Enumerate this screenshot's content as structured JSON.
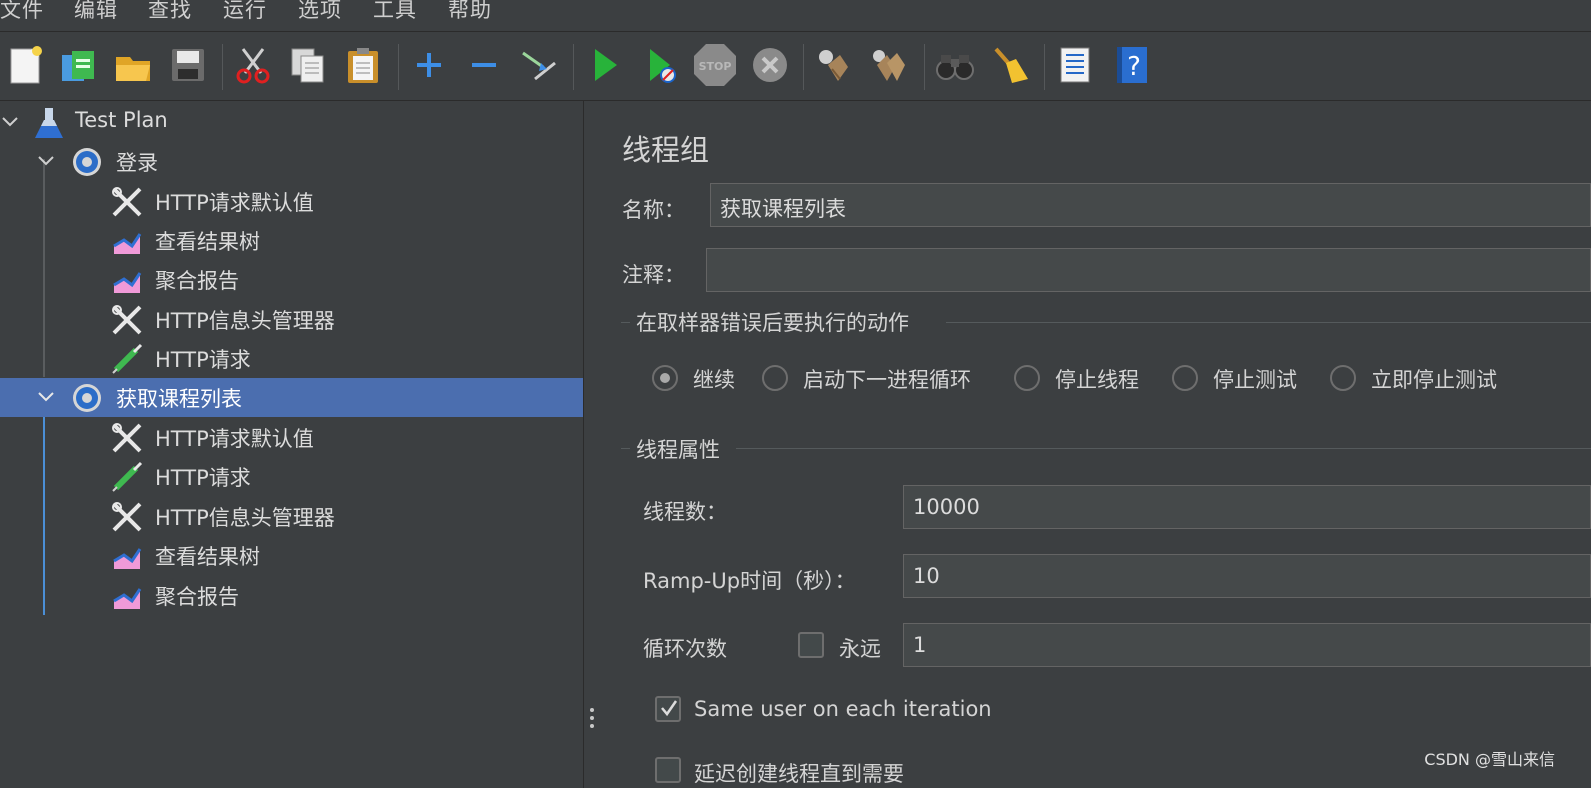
{
  "menu": [
    "文件",
    "编辑",
    "查找",
    "运行",
    "选项",
    "工具",
    "帮助"
  ],
  "toolbar": {
    "icons": [
      "new-icon",
      "templates-icon",
      "open-icon",
      "save-icon",
      "cut-icon",
      "copy-icon",
      "paste-icon",
      "expand-icon",
      "collapse-icon",
      "toggle-icon",
      "start-icon",
      "start-no-pause-icon",
      "stop-icon",
      "shutdown-icon",
      "clear-icon",
      "clear-all-icon",
      "search-icon",
      "reset-search-icon",
      "function-helper-icon",
      "help-icon"
    ]
  },
  "tree": {
    "root": "Test Plan",
    "groups": [
      {
        "label": "登录",
        "children": [
          "HTTP请求默认值",
          "查看结果树",
          "聚合报告",
          "HTTP信息头管理器",
          "HTTP请求"
        ]
      },
      {
        "label": "获取课程列表",
        "children": [
          "HTTP请求默认值",
          "HTTP请求",
          "HTTP信息头管理器",
          "查看结果树",
          "聚合报告"
        ]
      }
    ]
  },
  "panel": {
    "title": "线程组",
    "name_label": "名称：",
    "name_value": "获取课程列表",
    "comment_label": "注释：",
    "comment_value": "",
    "error_section": "在取样器错误后要执行的动作",
    "error_options": [
      "继续",
      "启动下一进程循环",
      "停止线程",
      "停止测试",
      "立即停止测试"
    ],
    "error_selected": "继续",
    "thread_section": "线程属性",
    "threads_label": "线程数：",
    "threads_value": "10000",
    "rampup_label": "Ramp-Up时间（秒）：",
    "rampup_value": "10",
    "loop_label": "循环次数",
    "forever_label": "永远",
    "forever_checked": false,
    "loop_value": "1",
    "same_user_label": "Same user on each iteration",
    "same_user_checked": true,
    "delay_label": "延迟创建线程直到需要",
    "delay_checked": false
  },
  "watermark": "CSDN @雪山来信",
  "colors": {
    "background": "#3c3f41",
    "selection": "#4b6eaf",
    "field": "#45494a"
  }
}
